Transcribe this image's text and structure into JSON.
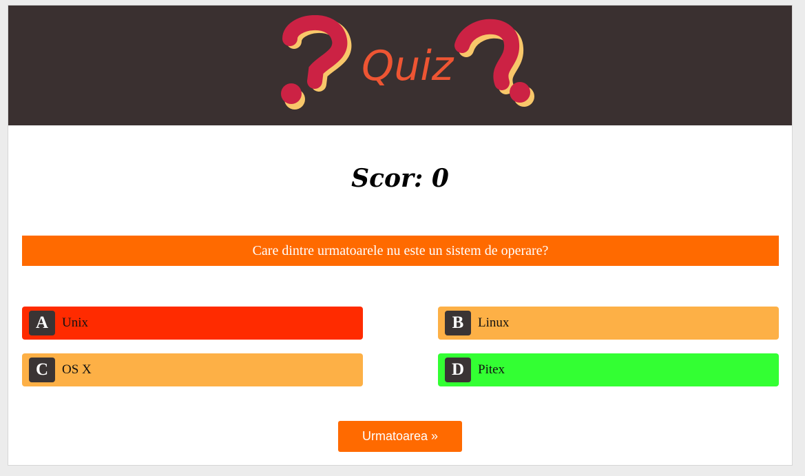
{
  "header": {
    "logo_text": "Quiz",
    "logo_icon": "question-mark-icon"
  },
  "score": {
    "label": "Scor: 0",
    "value": 0
  },
  "question": {
    "text": "Care dintre urmatoarele nu este un sistem de operare?"
  },
  "answers": [
    {
      "letter": "A",
      "text": "Unix",
      "color": "#ff2b00",
      "state": "wrong"
    },
    {
      "letter": "B",
      "text": "Linux",
      "color": "#fdb046",
      "state": "neutral"
    },
    {
      "letter": "C",
      "text": "OS X",
      "color": "#fdb046",
      "state": "neutral"
    },
    {
      "letter": "D",
      "text": "Pitex",
      "color": "#33ff33",
      "state": "correct"
    }
  ],
  "next_button": {
    "label": "Urmatoarea »"
  },
  "colors": {
    "header_bg": "#3a3030",
    "accent": "#ff6a00",
    "letter_badge": "#3a3434"
  }
}
